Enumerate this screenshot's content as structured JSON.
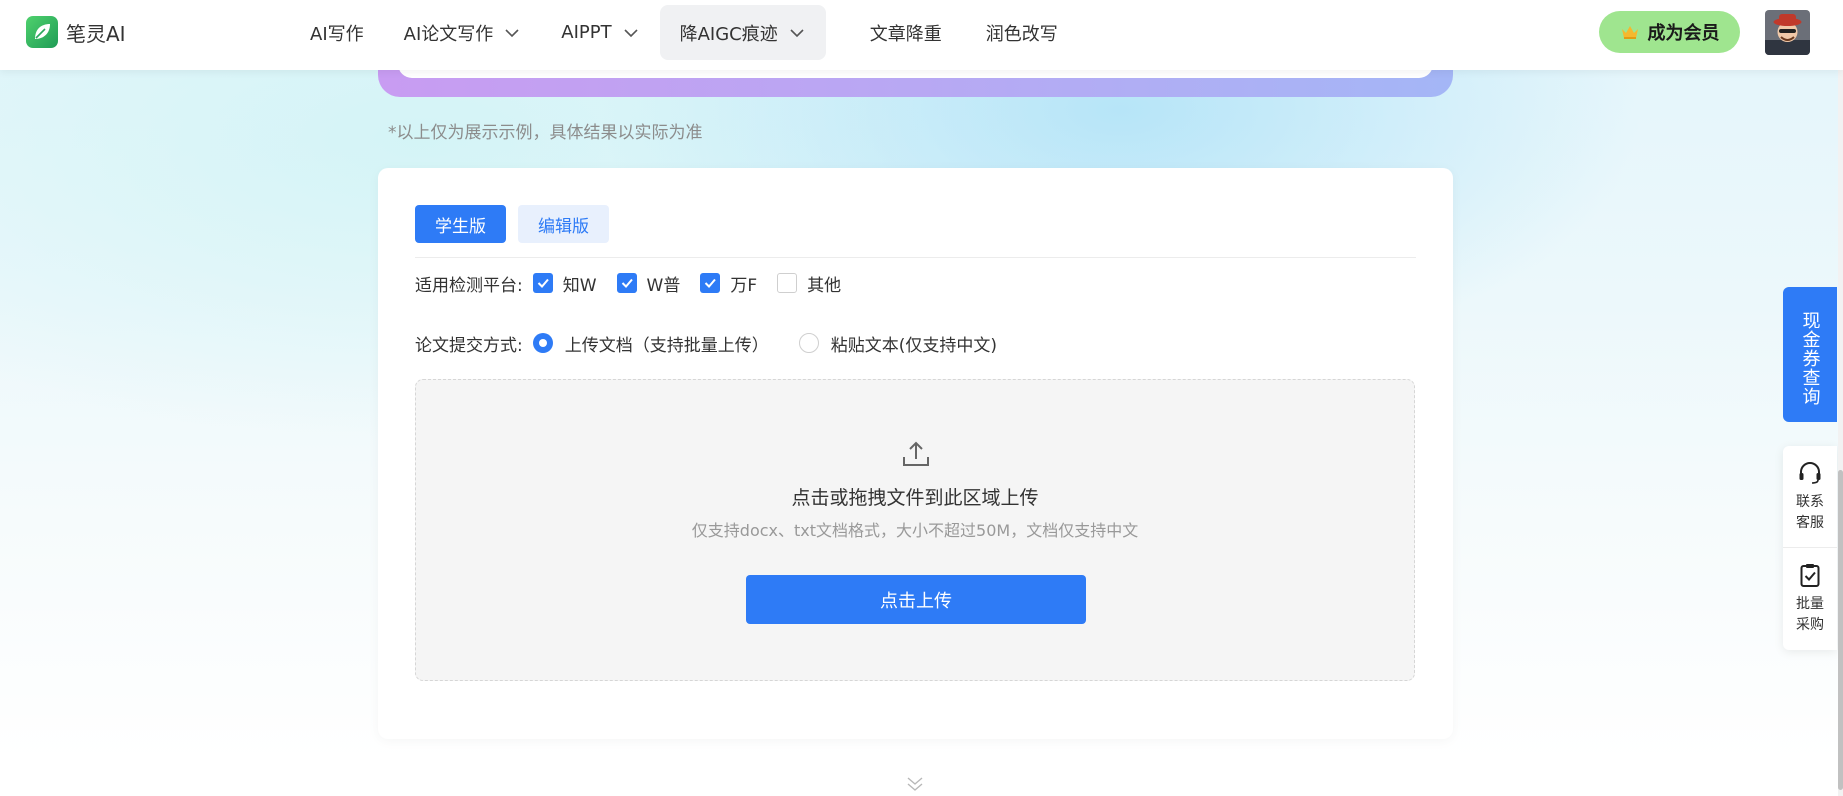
{
  "header": {
    "logo_text": "笔灵AI",
    "nav": [
      {
        "label": "AI写作",
        "dropdown": false,
        "active": false
      },
      {
        "label": "AI论文写作",
        "dropdown": true,
        "active": false
      },
      {
        "label": "AIPPT",
        "dropdown": true,
        "active": false
      },
      {
        "label": "降AIGC痕迹",
        "dropdown": true,
        "active": true
      },
      {
        "label": "文章降重",
        "dropdown": false,
        "active": false
      },
      {
        "label": "润色改写",
        "dropdown": false,
        "active": false
      }
    ],
    "vip_label": "成为会员"
  },
  "disclaimer": "*以上仅为展示示例，具体结果以实际为准",
  "card": {
    "tabs": [
      {
        "label": "学生版",
        "active": true
      },
      {
        "label": "编辑版",
        "active": false
      }
    ],
    "platform_label": "适用检测平台:",
    "platforms": [
      {
        "label": "知W",
        "checked": true
      },
      {
        "label": "W普",
        "checked": true
      },
      {
        "label": "万F",
        "checked": true
      },
      {
        "label": "其他",
        "checked": false
      }
    ],
    "submit_label": "论文提交方式:",
    "submit_options": [
      {
        "label": "上传文档（支持批量上传）",
        "selected": true
      },
      {
        "label": "粘贴文本(仅支持中文)",
        "selected": false
      }
    ],
    "dropzone": {
      "title": "点击或拖拽文件到此区域上传",
      "subtitle": "仅支持docx、txt文档格式，大小不超过50M，文档仅支持中文",
      "button": "点击上传"
    }
  },
  "side": {
    "coupon": "现金券查询",
    "items": [
      {
        "line1": "联系",
        "line2": "客服",
        "icon": "headset-icon"
      },
      {
        "line1": "批量",
        "line2": "采购",
        "icon": "clipboard-check-icon"
      }
    ]
  },
  "colors": {
    "primary": "#2e7bf6",
    "vip": "#9fe58f",
    "brand_green": "#1f9c56"
  }
}
